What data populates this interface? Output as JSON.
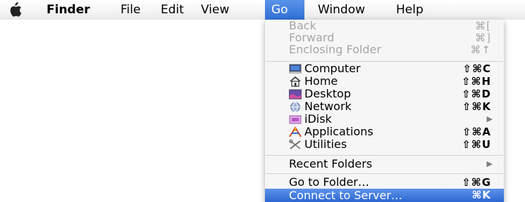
{
  "menubar": {
    "apple_icon": "apple-logo",
    "items": [
      {
        "label": "Finder"
      },
      {
        "label": "File"
      },
      {
        "label": "Edit"
      },
      {
        "label": "View"
      },
      {
        "label": "Go"
      },
      {
        "label": "Window"
      },
      {
        "label": "Help"
      }
    ],
    "active_item": "Go"
  },
  "go_menu": {
    "history": [
      {
        "label": "Back",
        "shortcut": "⌘[",
        "enabled": false
      },
      {
        "label": "Forward",
        "shortcut": "⌘]",
        "enabled": false
      },
      {
        "label": "Enclosing Folder",
        "shortcut": "⌘↑",
        "enabled": false
      }
    ],
    "places": [
      {
        "label": "Computer",
        "shortcut": "⇧⌘C",
        "icon": "computer-icon"
      },
      {
        "label": "Home",
        "shortcut": "⇧⌘H",
        "icon": "home-icon"
      },
      {
        "label": "Desktop",
        "shortcut": "⇧⌘D",
        "icon": "desktop-icon"
      },
      {
        "label": "Network",
        "shortcut": "⇧⌘K",
        "icon": "network-icon"
      },
      {
        "label": "iDisk",
        "shortcut": "",
        "icon": "idisk-icon",
        "submenu": true
      },
      {
        "label": "Applications",
        "shortcut": "⇧⌘A",
        "icon": "applications-icon"
      },
      {
        "label": "Utilities",
        "shortcut": "⇧⌘U",
        "icon": "utilities-icon"
      }
    ],
    "recent": {
      "label": "Recent Folders",
      "submenu": true
    },
    "connect": [
      {
        "label": "Go to Folder…",
        "shortcut": "⇧⌘G"
      },
      {
        "label": "Connect to Server…",
        "shortcut": "⌘K",
        "highlighted": true
      }
    ],
    "submenu_arrow": "▶",
    "highlight_color": "#3a77dc"
  }
}
